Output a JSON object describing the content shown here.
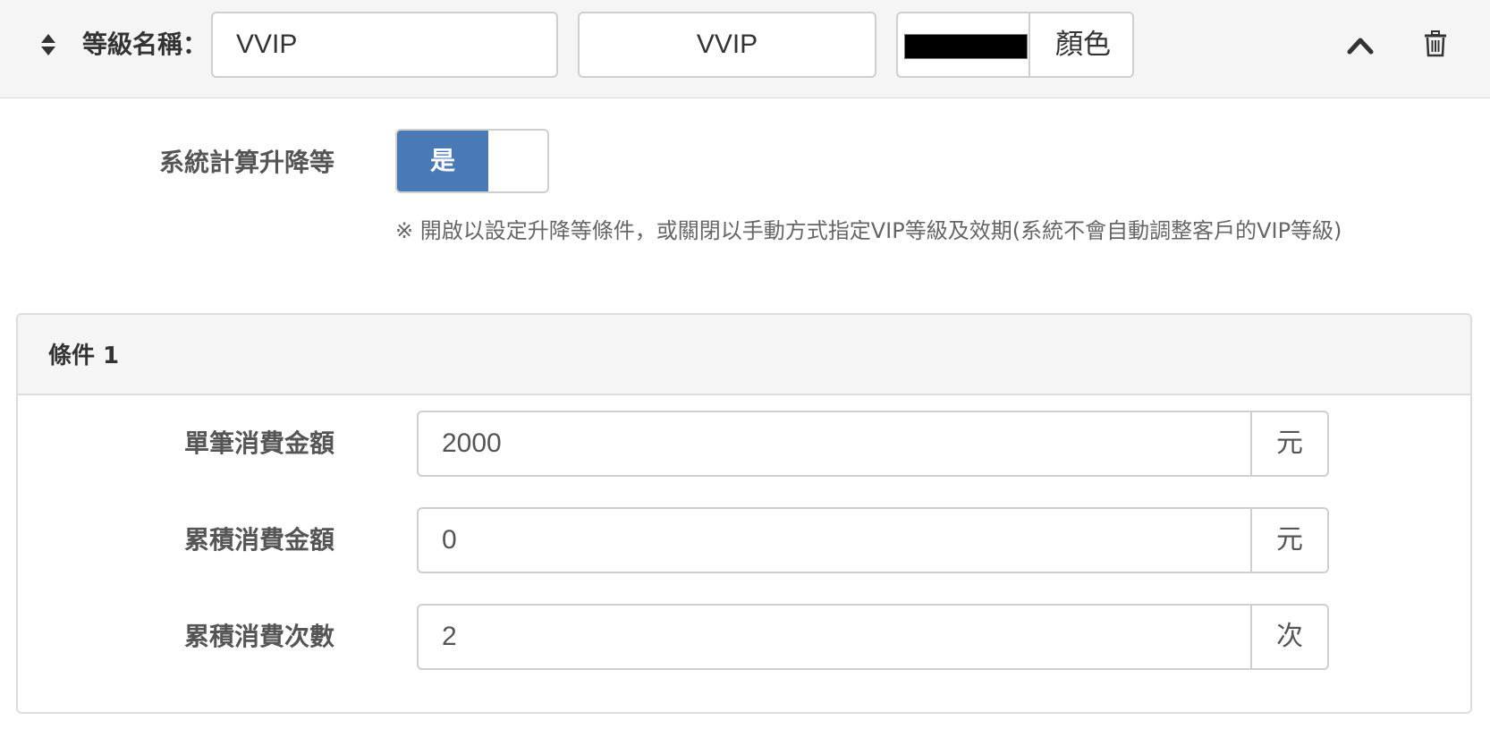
{
  "header": {
    "level_label": "等級名稱：",
    "name_value": "VVIP",
    "name_value_2": "VVIP",
    "color_value": "#000000",
    "color_button": "顏色"
  },
  "system_calc": {
    "label": "系統計算升降等",
    "toggle_on_label": "是",
    "enabled": true,
    "note": "※ 開啟以設定升降等條件，或關閉以手動方式指定VIP等級及效期(系統不會自動調整客戶的VIP等級)"
  },
  "condition": {
    "title": "條件 1",
    "rows": [
      {
        "label": "單筆消費金額",
        "value": "2000",
        "unit": "元"
      },
      {
        "label": "累積消費金額",
        "value": "0",
        "unit": "元"
      },
      {
        "label": "累積消費次數",
        "value": "2",
        "unit": "次"
      }
    ]
  },
  "colors": {
    "toggle_active": "#4a7ab5",
    "header_bg": "#f5f5f5",
    "border": "#cfcfcf"
  }
}
